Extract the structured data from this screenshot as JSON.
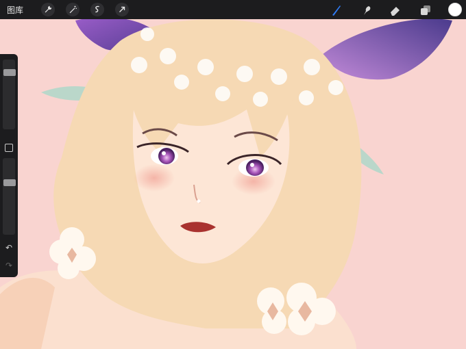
{
  "topbar": {
    "gallery_label": "图库",
    "left_tools": [
      "wrench-icon",
      "magic-wand-icon",
      "selection-icon",
      "transform-arrow-icon"
    ],
    "right_tools": [
      "brush-icon",
      "smudge-icon",
      "eraser-icon",
      "layers-icon"
    ],
    "active_tool": "brush-icon",
    "current_color": "#ffffff"
  },
  "sidebar": {
    "brush_size_level": 0.15,
    "opacity_level": 0.7,
    "buttons": [
      "modify-square-icon",
      "undo-icon",
      "redo-icon"
    ]
  },
  "colors": {
    "background": "#f9d4d0",
    "hair": "#f6d9b4",
    "eyes": "#a653b8",
    "wings": "#6a4aa8",
    "toolbar": "#1c1c1e",
    "accent": "#2f7cf6"
  }
}
